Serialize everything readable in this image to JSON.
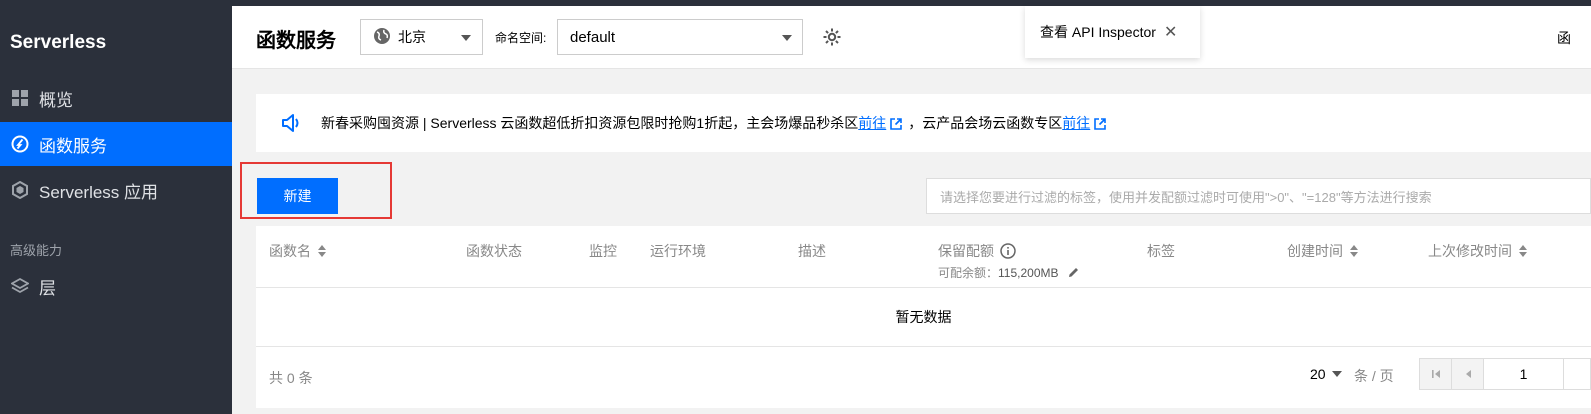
{
  "sidebar": {
    "brand": "Serverless",
    "items": [
      {
        "label": "概览",
        "icon": "grid-icon",
        "active": false
      },
      {
        "label": "函数服务",
        "icon": "function-icon",
        "active": true
      },
      {
        "label": "Serverless 应用",
        "icon": "app-icon",
        "active": false
      }
    ],
    "section_label": "高级能力",
    "advanced_items": [
      {
        "label": "层",
        "icon": "layers-icon"
      }
    ]
  },
  "header": {
    "title": "函数服务",
    "region": "北京",
    "namespace_label": "命名空间:",
    "namespace_value": "default",
    "inspector_label": "查看 API Inspector",
    "right_text": "函"
  },
  "banner": {
    "text1": "新春采购囤资源 | Serverless 云函数超低折扣资源包限时抢购1折起，主会场爆品秒杀区",
    "link1": "前往",
    "text2": "，云产品会场云函数专区",
    "link2": "前往"
  },
  "toolbar": {
    "new_button": "新建",
    "filter_placeholder": "请选择您要进行过滤的标签，使用并发配额过滤时可使用\">0\"、\"=128\"等方法进行搜索"
  },
  "table": {
    "columns": {
      "name": "函数名",
      "status": "函数状态",
      "monitor": "监控",
      "runtime": "运行环境",
      "desc": "描述",
      "quota": "保留配额",
      "tags": "标签",
      "created": "创建时间",
      "modified": "上次修改时间"
    },
    "quota_sub_label": "可配余额：",
    "quota_sub_value": "115,200MB",
    "empty_text": "暂无数据"
  },
  "pagination": {
    "total_text": "共 0 条",
    "page_size": "20",
    "per_page_label": "条 / 页",
    "current_page": "1"
  },
  "colors": {
    "accent": "#006eff",
    "sidebar_bg": "#2b303b",
    "highlight_border": "#e53935"
  }
}
